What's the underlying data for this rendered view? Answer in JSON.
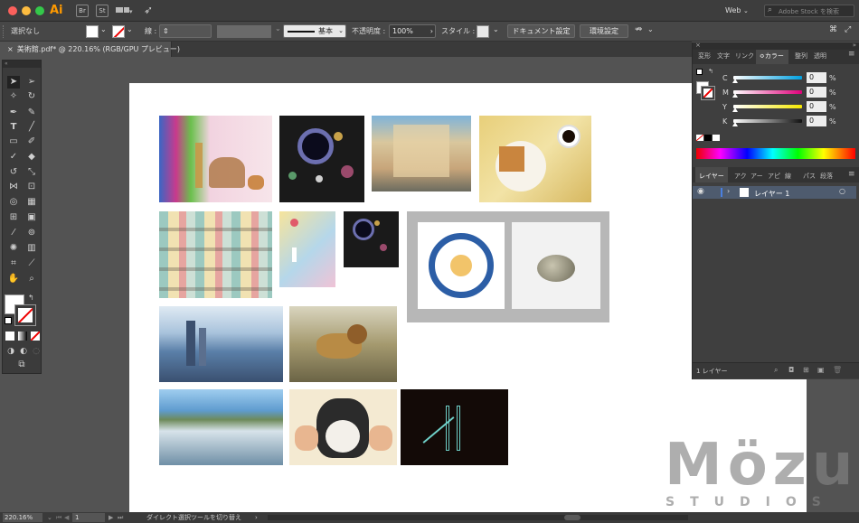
{
  "app": {
    "logo": "Ai",
    "bridge": "Br",
    "stock": "St"
  },
  "titlebar": {
    "workspace": "Web",
    "search_placeholder": "Adobe Stock を検索"
  },
  "control": {
    "selection": "選択なし",
    "stroke_label": "線 :",
    "stroke_style": "基本",
    "opacity_label": "不透明度 :",
    "opacity_value": "100%",
    "style_label": "スタイル :",
    "doc_settings": "ドキュメント設定",
    "preferences": "環境設定"
  },
  "document": {
    "tab_title": "美術館.pdf* @ 220.16% (RGB/GPU プレビュー)"
  },
  "color_panel": {
    "tabs": [
      "変形",
      "文字",
      "リンク",
      "カラー",
      "整列",
      "透明"
    ],
    "active_tab": "カラー",
    "channels": [
      {
        "label": "C",
        "value": "0",
        "unit": "%",
        "color": "#00a0e0"
      },
      {
        "label": "M",
        "value": "0",
        "unit": "%",
        "color": "#e0007a"
      },
      {
        "label": "Y",
        "value": "0",
        "unit": "%",
        "color": "#f5e800"
      },
      {
        "label": "K",
        "value": "0",
        "unit": "%",
        "color": "#111111"
      }
    ]
  },
  "layers_panel": {
    "tabs": [
      "レイヤー",
      "アク",
      "アー",
      "アピ",
      "線",
      "パス",
      "段落"
    ],
    "layer_name": "レイヤー 1",
    "footer": "1 レイヤー"
  },
  "statusbar": {
    "zoom": "220.16%",
    "page": "1",
    "tool_hint": "ダイレクト選択ツールを切り替え"
  },
  "watermark": {
    "line1": "Mözu",
    "line2": "STUDIOS"
  }
}
